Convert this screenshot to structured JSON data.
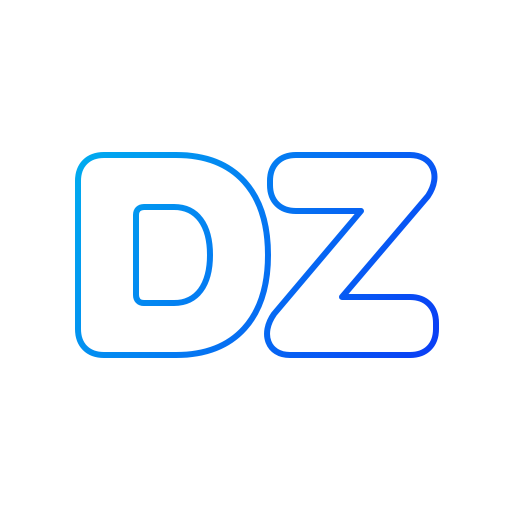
{
  "logo": {
    "text": "DZ",
    "style": "outline",
    "gradient_start": "#00AEEF",
    "gradient_end": "#0A3CF5",
    "background": "#FFFFFF"
  }
}
